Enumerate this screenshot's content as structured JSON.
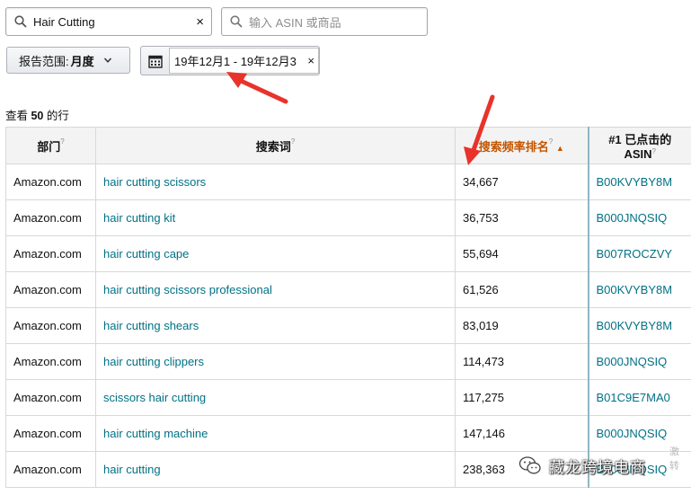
{
  "search": {
    "value": "Hair Cutting",
    "clear": "×",
    "asin_placeholder": "输入 ASIN 或商品"
  },
  "report_range": {
    "label": "报告范围: ",
    "value": "月度"
  },
  "date_range": {
    "text": "19年12月1 - 19年12月3",
    "clear": "×"
  },
  "row_count": {
    "prefix": "查看 ",
    "count": "50",
    "suffix": " 的行"
  },
  "table": {
    "headers": {
      "department": "部门",
      "search_term": "搜索词",
      "search_rank": "搜索频率排名",
      "top_asin": "#1 已点击的 ASIN",
      "info": "?",
      "sort_arrow": "▲"
    },
    "rows": [
      {
        "department": "Amazon.com",
        "term": "hair cutting scissors",
        "rank": "34,667",
        "asin": "B00KVYBY8M"
      },
      {
        "department": "Amazon.com",
        "term": "hair cutting kit",
        "rank": "36,753",
        "asin": "B000JNQSIQ"
      },
      {
        "department": "Amazon.com",
        "term": "hair cutting cape",
        "rank": "55,694",
        "asin": "B007ROCZVY"
      },
      {
        "department": "Amazon.com",
        "term": "hair cutting scissors professional",
        "rank": "61,526",
        "asin": "B00KVYBY8M"
      },
      {
        "department": "Amazon.com",
        "term": "hair cutting shears",
        "rank": "83,019",
        "asin": "B00KVYBY8M"
      },
      {
        "department": "Amazon.com",
        "term": "hair cutting clippers",
        "rank": "114,473",
        "asin": "B000JNQSIQ"
      },
      {
        "department": "Amazon.com",
        "term": "scissors hair cutting",
        "rank": "117,275",
        "asin": "B01C9E7MA0"
      },
      {
        "department": "Amazon.com",
        "term": "hair cutting machine",
        "rank": "147,146",
        "asin": "B000JNQSIQ"
      },
      {
        "department": "Amazon.com",
        "term": "hair cutting",
        "rank": "238,363",
        "asin": "B000JNQSIQ"
      }
    ]
  },
  "watermark": {
    "text": "藏龙跨境电商",
    "side_line1": "激",
    "side_line2": "转"
  },
  "colors": {
    "link": "#007185",
    "sorted_header": "#c45500",
    "annotation_arrow": "#e8332b"
  },
  "icons": {
    "search": "search-icon",
    "calendar": "calendar-icon",
    "chevron": "chevron-down-icon"
  }
}
